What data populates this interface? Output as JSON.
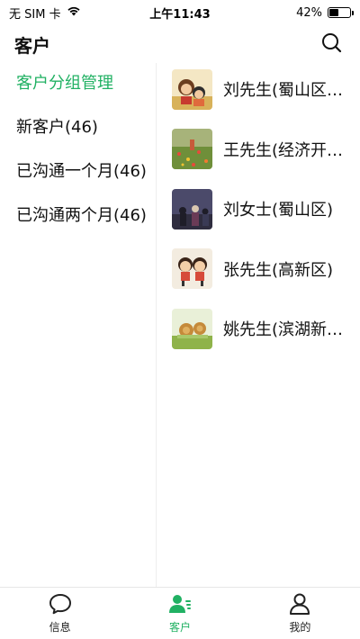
{
  "status_bar": {
    "carrier": "无 SIM 卡",
    "time": "上午11:43",
    "battery": "42%",
    "battery_level": 0.42,
    "wifi_icon": "wifi-icon",
    "battery_icon": "battery-icon"
  },
  "header": {
    "title": "客户",
    "search_icon": "search-icon"
  },
  "accent_color": "#21b163",
  "menu": {
    "items": [
      {
        "label": "客户分组管理",
        "active": true
      },
      {
        "label": "新客户(46)",
        "active": false
      },
      {
        "label": "已沟通一个月(46)",
        "active": false
      },
      {
        "label": "已沟通两个月(46)",
        "active": false
      }
    ]
  },
  "contacts": [
    {
      "name": "刘先生(蜀山区区...",
      "avatar": "avatar-cartoon-couple"
    },
    {
      "name": "王先生(经济开发区",
      "avatar": "avatar-flower-field"
    },
    {
      "name": "刘女士(蜀山区)",
      "avatar": "avatar-night-crowd"
    },
    {
      "name": "张先生(高新区)",
      "avatar": "avatar-cartoon-kids"
    },
    {
      "name": "姚先生(滨湖新区区",
      "avatar": "avatar-snail-couple"
    }
  ],
  "tabs": [
    {
      "label": "信息",
      "icon": "chat-bubble-icon",
      "active": false
    },
    {
      "label": "客户",
      "icon": "customers-icon",
      "active": true
    },
    {
      "label": "我的",
      "icon": "profile-icon",
      "active": false
    }
  ]
}
